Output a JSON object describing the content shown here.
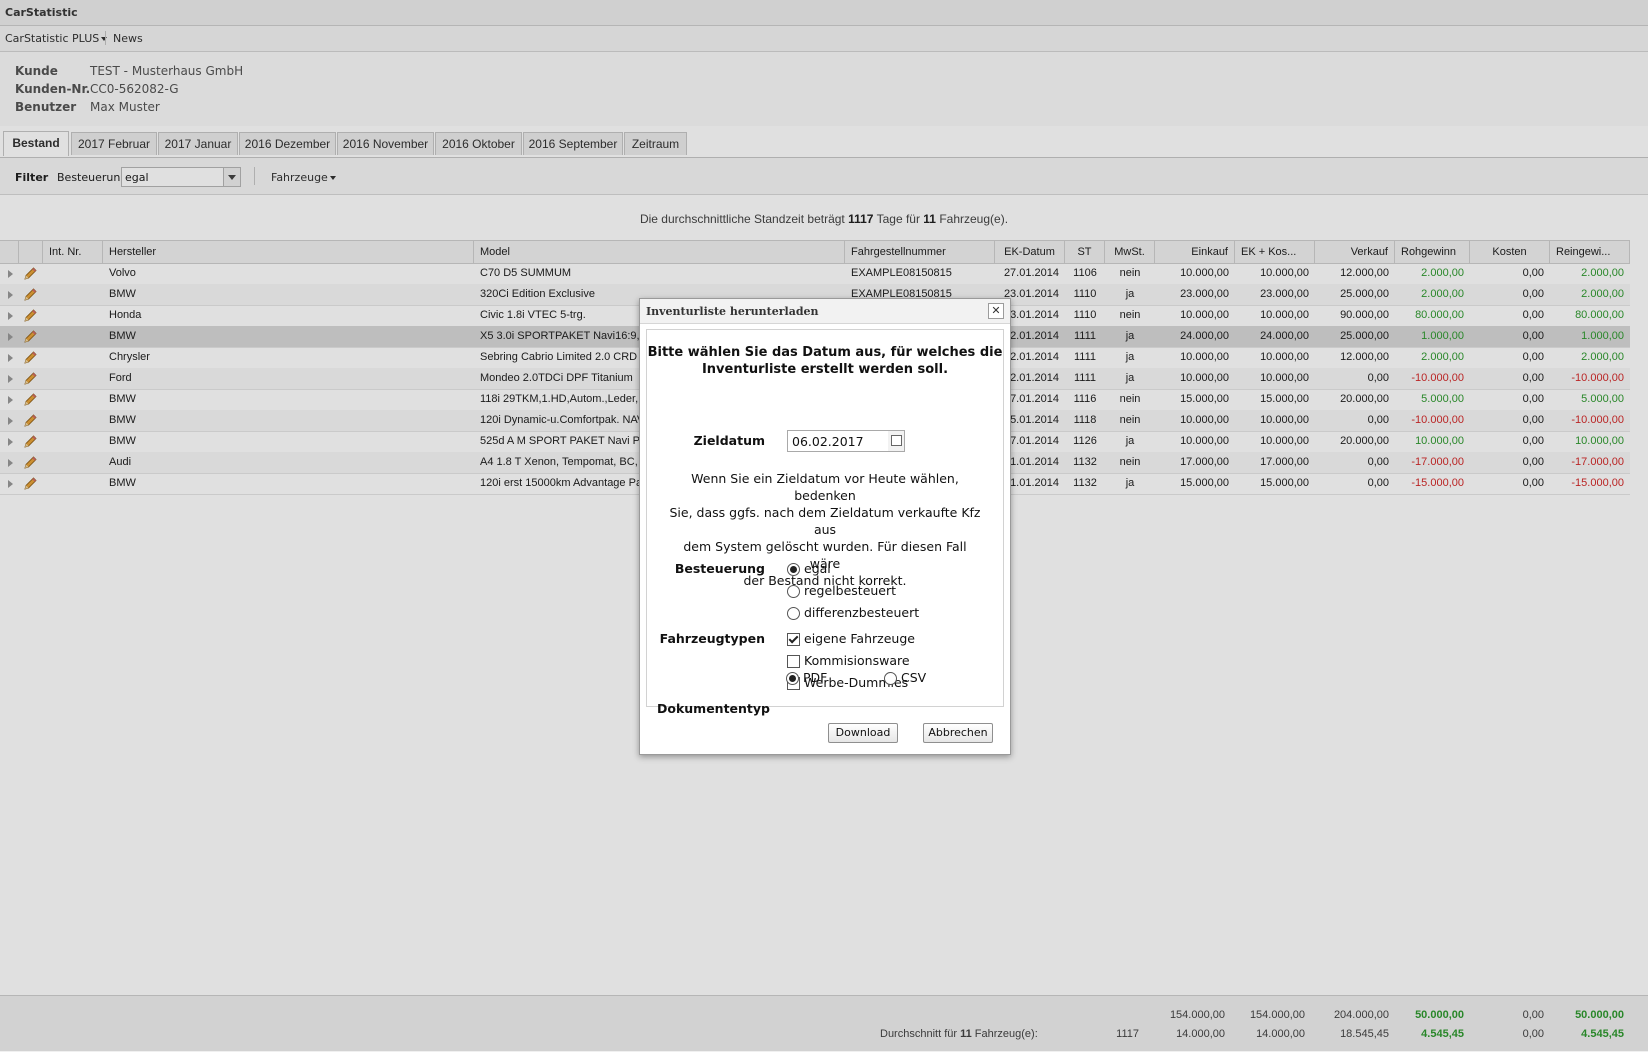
{
  "app": {
    "title": "CarStatistic"
  },
  "menu": {
    "plus": "CarStatistic PLUS",
    "news": "News"
  },
  "customer": {
    "kunde_label": "Kunde",
    "kunde_value": "TEST - Musterhaus GmbH",
    "nr_label": "Kunden-Nr.",
    "nr_value": "CC0-562082-G",
    "benutzer_label": "Benutzer",
    "benutzer_value": "Max Muster"
  },
  "tabs": [
    "Bestand",
    "2017 Februar",
    "2017 Januar",
    "2016 Dezember",
    "2016 November",
    "2016 Oktober",
    "2016 September",
    "Zeitraum"
  ],
  "filter": {
    "label": "Filter",
    "besteuerung_label": "Besteuerung",
    "besteuerung_value": "egal",
    "fahrzeuge": "Fahrzeuge"
  },
  "summary": {
    "prefix": "Die durchschnittliche Standzeit beträgt",
    "days": "1117",
    "mid": "Tage für",
    "count": "11",
    "suffix": "Fahrzeug(e)."
  },
  "columns": [
    "Int. Nr.",
    "Hersteller",
    "Model",
    "Fahrgestellnummer",
    "EK-Datum",
    "ST",
    "MwSt.",
    "Einkauf",
    "EK + Kos...",
    "Verkauf",
    "Rohgewinn",
    "Kosten",
    "Reingewi..."
  ],
  "rows": [
    {
      "intnr": "",
      "hersteller": "Volvo",
      "model": "C70 D5 SUMMUM",
      "fgn": "EXAMPLE08150815",
      "ekdatum": "27.01.2014",
      "st": "1106",
      "mwst": "nein",
      "einkauf": "10.000,00",
      "ekkos": "10.000,00",
      "verkauf": "12.000,00",
      "rohgewinn": "2.000,00",
      "kosten": "0,00",
      "reingewinn": "2.000,00",
      "sign": "pos"
    },
    {
      "intnr": "",
      "hersteller": "BMW",
      "model": "320Ci Edition Exclusive",
      "fgn": "EXAMPLE08150815",
      "ekdatum": "23.01.2014",
      "st": "1110",
      "mwst": "ja",
      "einkauf": "23.000,00",
      "ekkos": "23.000,00",
      "verkauf": "25.000,00",
      "rohgewinn": "2.000,00",
      "kosten": "0,00",
      "reingewinn": "2.000,00",
      "sign": "pos"
    },
    {
      "intnr": "",
      "hersteller": "Honda",
      "model": "Civic 1.8i VTEC 5-trg.",
      "fgn": "",
      "ekdatum": "3.01.2014",
      "st": "1110",
      "mwst": "nein",
      "einkauf": "10.000,00",
      "ekkos": "10.000,00",
      "verkauf": "90.000,00",
      "rohgewinn": "80.000,00",
      "kosten": "0,00",
      "reingewinn": "80.000,00",
      "sign": "pos"
    },
    {
      "intnr": "",
      "hersteller": "BMW",
      "model": "X5 3.0i SPORTPAKET Navi16:9,Le",
      "fgn": "",
      "ekdatum": "2.01.2014",
      "st": "1111",
      "mwst": "ja",
      "einkauf": "24.000,00",
      "ekkos": "24.000,00",
      "verkauf": "25.000,00",
      "rohgewinn": "1.000,00",
      "kosten": "0,00",
      "reingewinn": "1.000,00",
      "sign": "pos"
    },
    {
      "intnr": "",
      "hersteller": "Chrysler",
      "model": "Sebring Cabrio Limited 2.0 CRD N",
      "fgn": "",
      "ekdatum": "2.01.2014",
      "st": "1111",
      "mwst": "ja",
      "einkauf": "10.000,00",
      "ekkos": "10.000,00",
      "verkauf": "12.000,00",
      "rohgewinn": "2.000,00",
      "kosten": "0,00",
      "reingewinn": "2.000,00",
      "sign": "pos"
    },
    {
      "intnr": "",
      "hersteller": "Ford",
      "model": "Mondeo 2.0TDCi DPF Titanium",
      "fgn": "",
      "ekdatum": "2.01.2014",
      "st": "1111",
      "mwst": "ja",
      "einkauf": "10.000,00",
      "ekkos": "10.000,00",
      "verkauf": "0,00",
      "rohgewinn": "-10.000,00",
      "kosten": "0,00",
      "reingewinn": "-10.000,00",
      "sign": "neg"
    },
    {
      "intnr": "",
      "hersteller": "BMW",
      "model": "118i 29TKM,1.HD,Autom.,Leder,Pl",
      "fgn": "",
      "ekdatum": "7.01.2014",
      "st": "1116",
      "mwst": "nein",
      "einkauf": "15.000,00",
      "ekkos": "15.000,00",
      "verkauf": "20.000,00",
      "rohgewinn": "5.000,00",
      "kosten": "0,00",
      "reingewinn": "5.000,00",
      "sign": "pos"
    },
    {
      "intnr": "",
      "hersteller": "BMW",
      "model": "120i Dynamic-u.Comfortpak. NAV",
      "fgn": "",
      "ekdatum": "5.01.2014",
      "st": "1118",
      "mwst": "nein",
      "einkauf": "10.000,00",
      "ekkos": "10.000,00",
      "verkauf": "0,00",
      "rohgewinn": "-10.000,00",
      "kosten": "0,00",
      "reingewinn": "-10.000,00",
      "sign": "neg"
    },
    {
      "intnr": "",
      "hersteller": "BMW",
      "model": "525d A M SPORT PAKET Navi Pro",
      "fgn": "",
      "ekdatum": "7.01.2014",
      "st": "1126",
      "mwst": "ja",
      "einkauf": "10.000,00",
      "ekkos": "10.000,00",
      "verkauf": "20.000,00",
      "rohgewinn": "10.000,00",
      "kosten": "0,00",
      "reingewinn": "10.000,00",
      "sign": "pos"
    },
    {
      "intnr": "",
      "hersteller": "Audi",
      "model": "A4 1.8 T Xenon, Tempomat, BC, F",
      "fgn": "",
      "ekdatum": "1.01.2014",
      "st": "1132",
      "mwst": "nein",
      "einkauf": "17.000,00",
      "ekkos": "17.000,00",
      "verkauf": "0,00",
      "rohgewinn": "-17.000,00",
      "kosten": "0,00",
      "reingewinn": "-17.000,00",
      "sign": "neg"
    },
    {
      "intnr": "",
      "hersteller": "BMW",
      "model": "120i erst 15000km Advantage Pa",
      "fgn": "",
      "ekdatum": "1.01.2014",
      "st": "1132",
      "mwst": "ja",
      "einkauf": "15.000,00",
      "ekkos": "15.000,00",
      "verkauf": "0,00",
      "rohgewinn": "-15.000,00",
      "kosten": "0,00",
      "reingewinn": "-15.000,00",
      "sign": "neg"
    }
  ],
  "totals": {
    "einkauf": "154.000,00",
    "ekkos": "154.000,00",
    "verkauf": "204.000,00",
    "rohgewinn": "50.000,00",
    "kosten": "0,00",
    "reingewinn": "50.000,00",
    "avg_label": "Durchschnitt für",
    "avg_count": "11",
    "avg_suffix": "Fahrzeug(e):",
    "avg_st": "1117",
    "avg_einkauf": "14.000,00",
    "avg_ekkos": "14.000,00",
    "avg_verkauf": "18.545,45",
    "avg_rohgewinn": "4.545,45",
    "avg_kosten": "0,00",
    "avg_reingewinn": "4.545,45"
  },
  "dialog": {
    "title": "Inventurliste herunterladen",
    "close": "✕",
    "heading_line1": "Bitte wählen Sie das Datum aus, für welches die",
    "heading_line2": "Inventurliste erstellt werden soll.",
    "zieldatum_label": "Zieldatum",
    "zieldatum_value": "06.02.2017",
    "note_line1": "Wenn Sie ein Zieldatum vor Heute wählen, bedenken",
    "note_line2": "Sie, dass ggfs. nach dem Zieldatum verkaufte Kfz aus",
    "note_line3": "dem System gelöscht wurden. Für diesen Fall wäre",
    "note_line4": "der Bestand nicht korrekt.",
    "besteuerung_label": "Besteuerung",
    "besteuerung_options": [
      "egal",
      "regelbesteuert",
      "differenzbesteuert"
    ],
    "fahrzeugtypen_label": "Fahrzeugtypen",
    "fahrzeugtypen_options": [
      "eigene Fahrzeuge",
      "Kommisionsware",
      "Werbe-Dummies"
    ],
    "dokumenttyp_label": "Dokumententyp",
    "dokumenttyp_options": [
      "PDF",
      "CSV"
    ],
    "download": "Download",
    "abbrechen": "Abbrechen"
  }
}
